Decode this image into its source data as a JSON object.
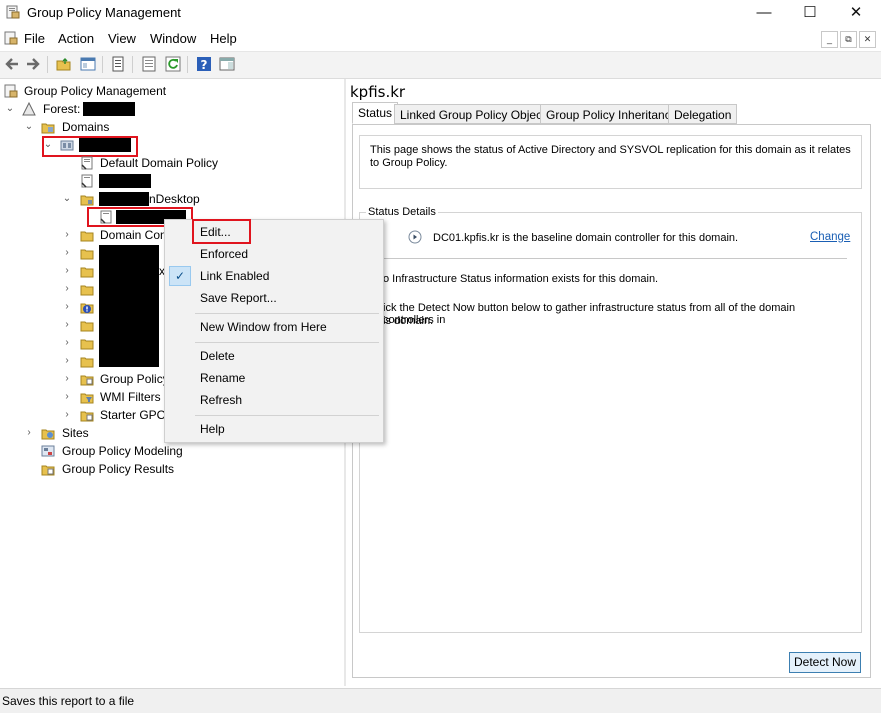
{
  "window": {
    "title": "Group Policy Management",
    "controls": [
      "—",
      "☐",
      "✕"
    ]
  },
  "menu": [
    "File",
    "Action",
    "View",
    "Window",
    "Help"
  ],
  "mdi_controls": [
    "_",
    "⧉",
    "✕"
  ],
  "tree": {
    "root": "Group Policy Management",
    "forest": "Forest:",
    "domains": "Domains",
    "default_domain_policy": "Default Domain Policy",
    "ou_desktop_suffix": "nDesktop",
    "domain_con": "Domain Con",
    "x_suffix": "x",
    "group_policy_objects": "Group Policy",
    "wmi_filters": "WMI Filters",
    "starter_gpos": "Starter GPOs",
    "sites": "Sites",
    "modeling": "Group Policy Modeling",
    "results": "Group Policy Results"
  },
  "context_menu": {
    "edit": "Edit...",
    "enforced": "Enforced",
    "link_enabled": "Link Enabled",
    "check": "✓",
    "save_report": "Save Report...",
    "new_window": "New Window from Here",
    "delete": "Delete",
    "rename": "Rename",
    "refresh": "Refresh",
    "help": "Help"
  },
  "right": {
    "title": "kpfis.kr",
    "tabs": [
      "Status",
      "Linked Group Policy Objects",
      "Group Policy Inheritance",
      "Delegation"
    ],
    "info": "This page shows the status of Active Directory and SYSVOL replication for this domain as it relates to Group Policy.",
    "status_details": "Status Details",
    "baseline": "DC01.kpfis.kr is the baseline domain controller for this domain.",
    "change": "Change",
    "no_info": "o Infrastructure Status information exists for this domain.",
    "click_detect": "ick the Detect Now button below to gather infrastructure status from all of the domain controllers in",
    "this_domain": "is domain.",
    "detect_now": "Detect Now"
  },
  "status_bar": "Saves this report to a file",
  "colors": {
    "highlight_red": "#e0141e",
    "link_blue": "#1a5fb4",
    "check_bg": "#cce4f7"
  }
}
